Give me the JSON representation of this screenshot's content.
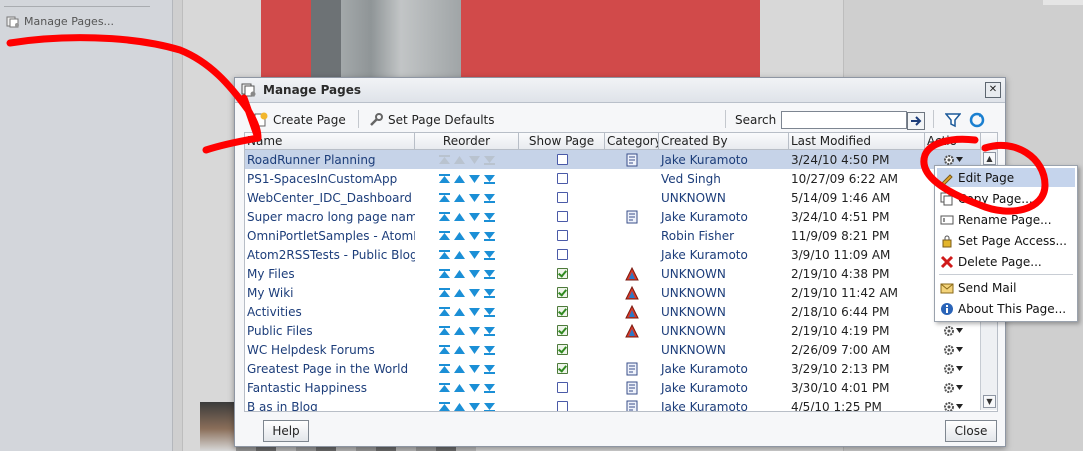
{
  "background": {
    "sidebar_link": "Manage Pages..."
  },
  "dialog": {
    "title": "Manage Pages",
    "toolbar": {
      "create_page": "Create Page",
      "set_defaults": "Set Page Defaults",
      "search_label": "Search",
      "search_value": ""
    },
    "columns": [
      "Name",
      "Reorder",
      "Show Page",
      "Category",
      "Created By",
      "Last Modified",
      "Actio"
    ],
    "rows": [
      {
        "name": "RoadRunner Planning",
        "show": false,
        "category": "page",
        "created_by": "Jake Kuramoto",
        "modified": "3/24/10 4:50 PM",
        "selected": true
      },
      {
        "name": "PS1-SpacesInCustomApp",
        "show": false,
        "category": "",
        "created_by": "Ved Singh",
        "modified": "10/27/09 6:22 AM"
      },
      {
        "name": "WebCenter_IDC_Dashboard",
        "show": false,
        "category": "",
        "created_by": "UNKNOWN",
        "modified": "5/14/09 1:46 AM"
      },
      {
        "name": "Super macro long page name f",
        "show": false,
        "category": "page",
        "created_by": "Jake Kuramoto",
        "modified": "3/24/10 4:51 PM"
      },
      {
        "name": "OmniPortletSamples - AtomFee",
        "show": false,
        "category": "",
        "created_by": "Robin Fisher",
        "modified": "11/9/09 8:21 PM"
      },
      {
        "name": "Atom2RSSTests - Public Blog",
        "show": false,
        "category": "",
        "created_by": "Jake Kuramoto",
        "modified": "3/9/10 11:09 AM"
      },
      {
        "name": "My Files",
        "show": true,
        "category": "warn",
        "created_by": "UNKNOWN",
        "modified": "2/19/10 4:38 PM"
      },
      {
        "name": "My Wiki",
        "show": true,
        "category": "warn",
        "created_by": "UNKNOWN",
        "modified": "2/19/10 11:42 AM"
      },
      {
        "name": "Activities",
        "show": true,
        "category": "warn",
        "created_by": "UNKNOWN",
        "modified": "2/18/10 6:44 PM"
      },
      {
        "name": "Public Files",
        "show": true,
        "category": "warn",
        "created_by": "UNKNOWN",
        "modified": "2/19/10 4:19 PM"
      },
      {
        "name": "WC Helpdesk Forums",
        "show": true,
        "category": "",
        "created_by": "UNKNOWN",
        "modified": "2/26/09 7:00 AM"
      },
      {
        "name": "Greatest Page in the World",
        "show": true,
        "category": "page",
        "created_by": "Jake Kuramoto",
        "modified": "3/29/10 2:13 PM"
      },
      {
        "name": "Fantastic Happiness",
        "show": false,
        "category": "page",
        "created_by": "Jake Kuramoto",
        "modified": "3/30/10 4:01 PM"
      },
      {
        "name": "B as in Blog",
        "show": false,
        "category": "page",
        "created_by": "Jake Kuramoto",
        "modified": "4/5/10 1:25 PM"
      }
    ],
    "help_button": "Help",
    "close_button": "Close"
  },
  "context_menu": {
    "items": [
      "Edit Page",
      "Copy Page...",
      "Rename Page...",
      "Set Page Access...",
      "Delete Page...",
      "Send Mail",
      "About This Page..."
    ]
  },
  "colors": {
    "accent": "#1c3d7a",
    "selection": "#c6d3e8",
    "annotation": "#ff0000"
  }
}
